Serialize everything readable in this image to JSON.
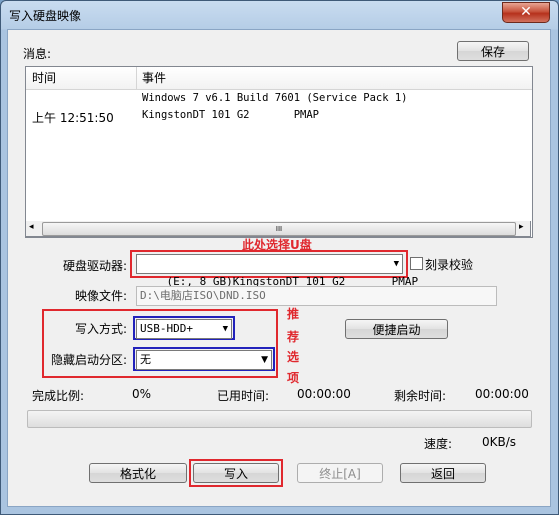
{
  "window": {
    "title": "写入硬盘映像",
    "close_glyph": "✕"
  },
  "messages": {
    "label": "消息:",
    "save_label": "保存",
    "columns": [
      "时间",
      "事件"
    ],
    "rows": [
      {
        "time": "",
        "event": "Windows 7 v6.1 Build 7601 (Service Pack 1)"
      },
      {
        "time": "上午 12:51:50",
        "event": "KingstonDT 101 G2       PMAP"
      }
    ],
    "scroll_thumb": "III"
  },
  "drive": {
    "label": "硬盘驱动器:",
    "value": "(E:, 8 GB)KingstonDT 101 G2       PMAP",
    "annotation": "此处选择U盘",
    "verify_label": "刻录校验",
    "verify_checked": false
  },
  "image_file": {
    "label": "映像文件:",
    "value": "D:\\电脑店ISO\\DND.ISO"
  },
  "write_mode": {
    "label": "写入方式:",
    "value": "USB-HDD+"
  },
  "hidden_partition": {
    "label": "隐藏启动分区:",
    "value": "无"
  },
  "recommend_annotation": [
    "推",
    "荐",
    "选",
    "项"
  ],
  "quick_boot_label": "便捷启动",
  "status": {
    "progress_label": "完成比例:",
    "progress_value": "0%",
    "elapsed_label": "已用时间:",
    "elapsed_value": "00:00:00",
    "remaining_label": "剩余时间:",
    "remaining_value": "00:00:00",
    "speed_label": "速度:",
    "speed_value": "0KB/s",
    "progress_fraction": 0
  },
  "buttons": {
    "format": "格式化",
    "write": "写入",
    "abort": "终止[A]",
    "back": "返回"
  },
  "colors": {
    "annotation_red": "#e0282e",
    "annotation_blue": "#2222bb"
  }
}
